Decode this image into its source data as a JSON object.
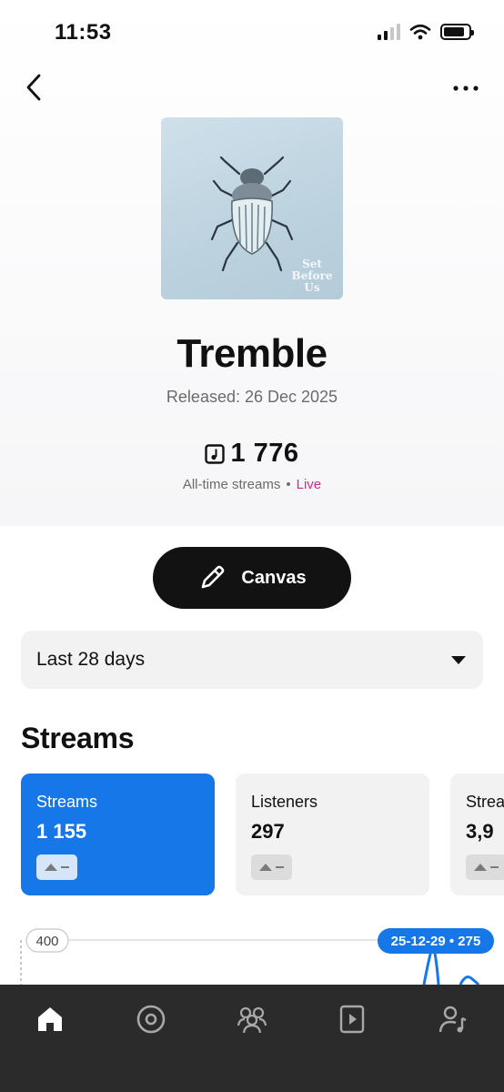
{
  "status_bar": {
    "time": "11:53",
    "icons": [
      "cellular-signal-icon",
      "wifi-icon",
      "battery-icon"
    ]
  },
  "header": {
    "back_icon": "chevron-left-icon",
    "more_icon": "more-horizontal-icon"
  },
  "release": {
    "cover_text": "Set Before Us",
    "title": "Tremble",
    "released_line": "Released: 26 Dec 2025",
    "all_time_streams": "1 776",
    "all_time_label": "All-time streams",
    "separator": "•",
    "live_label": "Live",
    "stream_icon": "music-note-square-icon"
  },
  "canvas_button": {
    "label": "Canvas",
    "icon": "pencil-icon"
  },
  "date_range": {
    "selected": "Last 28 days",
    "icon": "caret-down-icon"
  },
  "streams_section": {
    "title": "Streams",
    "cards": [
      {
        "label": "Streams",
        "value": "1 155",
        "active": true
      },
      {
        "label": "Listeners",
        "value": "297",
        "active": false
      },
      {
        "label": "Strea",
        "value": "3,9",
        "active": false
      }
    ]
  },
  "chart_data": {
    "type": "line",
    "y_tick": "400",
    "tooltip": "25-12-29 • 275",
    "tooltip_date": "25-12-29",
    "tooltip_value": 275
  },
  "colors": {
    "accent_blue": "#1677e8",
    "live_pink": "#d12a8f",
    "nav_background": "#2b2b2b",
    "button_dark": "#121212"
  },
  "bottom_nav": {
    "items": [
      {
        "icon": "home-icon",
        "active": true
      },
      {
        "icon": "disc-icon",
        "active": false
      },
      {
        "icon": "audience-icon",
        "active": false
      },
      {
        "icon": "video-play-icon",
        "active": false
      },
      {
        "icon": "artist-profile-icon",
        "active": false
      }
    ]
  }
}
